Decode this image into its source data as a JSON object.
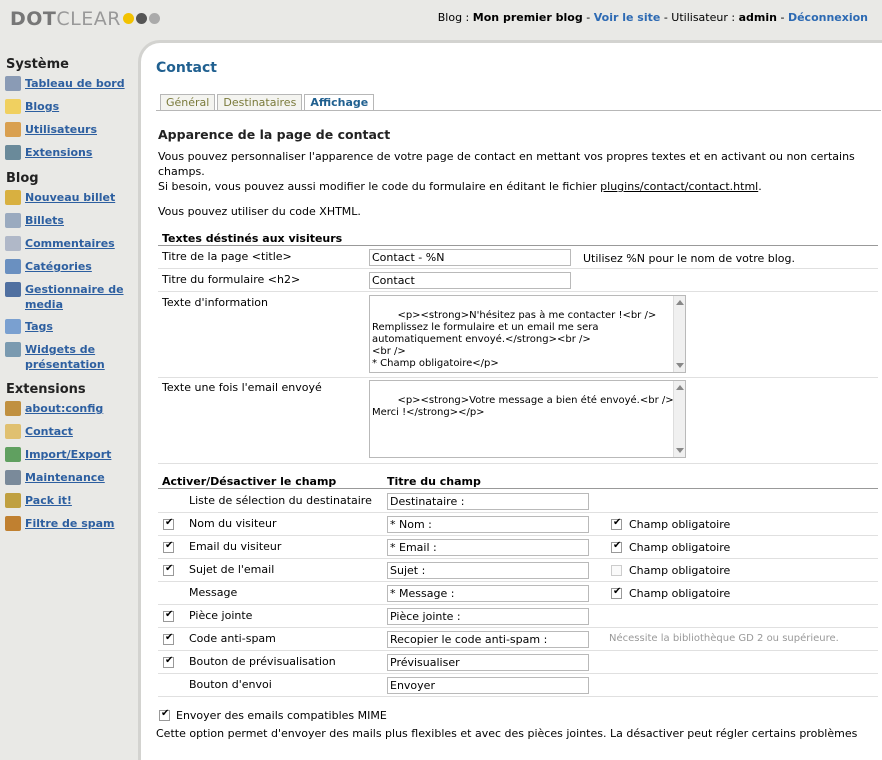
{
  "header": {
    "logo_a": "DOT",
    "logo_b": "CLEAR",
    "blog_label": "Blog :",
    "blog_name": "Mon premier blog",
    "sep1": "-",
    "view_site": "Voir le site",
    "sep2": "-",
    "user_label": "Utilisateur :",
    "user_name": "admin",
    "sep3": "-",
    "logout": "Déconnexion",
    "dot_colors": [
      "#f2c200",
      "#555555",
      "#aaaaaa"
    ]
  },
  "sidebar": {
    "system_title": "Système",
    "system": [
      {
        "label": "Tableau de bord",
        "icon": "dashboard-icon",
        "color": "#8a9bb5"
      },
      {
        "label": "Blogs",
        "icon": "blogs-icon",
        "color": "#f0d060"
      },
      {
        "label": "Utilisateurs",
        "icon": "users-icon",
        "color": "#d9a050"
      },
      {
        "label": "Extensions",
        "icon": "plugins-icon",
        "color": "#6a8a9a"
      }
    ],
    "blog_title": "Blog",
    "blog": [
      {
        "label": "Nouveau billet",
        "icon": "new-post-icon",
        "color": "#d8b040"
      },
      {
        "label": "Billets",
        "icon": "posts-icon",
        "color": "#9aaabf"
      },
      {
        "label": "Commentaires",
        "icon": "comments-icon",
        "color": "#b0b8c8"
      },
      {
        "label": "Catégories",
        "icon": "categories-icon",
        "color": "#6a90c0"
      },
      {
        "label": "Gestionnaire de media",
        "icon": "media-icon",
        "color": "#5070a0"
      },
      {
        "label": "Tags",
        "icon": "tags-icon",
        "color": "#7aa0d0"
      },
      {
        "label": "Widgets de présentation",
        "icon": "widgets-icon",
        "color": "#7a9ab0"
      }
    ],
    "ext_title": "Extensions",
    "ext": [
      {
        "label": "about:config",
        "icon": "config-icon",
        "color": "#c09040"
      },
      {
        "label": "Contact",
        "icon": "contact-icon",
        "color": "#e0c070"
      },
      {
        "label": "Import/Export",
        "icon": "import-export-icon",
        "color": "#60a060"
      },
      {
        "label": "Maintenance",
        "icon": "maintenance-icon",
        "color": "#7a8a9a"
      },
      {
        "label": "Pack it!",
        "icon": "pack-icon",
        "color": "#c0a040"
      },
      {
        "label": "Filtre de spam",
        "icon": "spam-filter-icon",
        "color": "#c08030"
      }
    ]
  },
  "page": {
    "title": "Contact",
    "tabs": [
      "Général",
      "Destinataires",
      "Affichage"
    ],
    "section_title": "Apparence de la page de contact",
    "intro1": "Vous pouvez personnaliser l'apparence de votre page de contact en mettant vos propres textes et en activant ou non certains champs.",
    "intro2_prefix": "Si besoin, vous pouvez aussi modifier le code du formulaire en éditant le fichier ",
    "intro2_link": "plugins/contact/contact.html",
    "intro2_suffix": ".",
    "intro3": "Vous pouvez utiliser du code XHTML.",
    "visitor_texts_title": "Textes déstinés aux visiteurs",
    "page_title_label": "Titre de la page <title>",
    "page_title_value": "Contact - %N",
    "page_title_hint": "Utilisez %N pour le nom de votre blog.",
    "form_title_label": "Titre du formulaire <h2>",
    "form_title_value": "Contact",
    "info_label": "Texte d'information",
    "info_value": "<p><strong>N'hésitez pas à me contacter !<br />\nRemplissez le formulaire et un email me sera automatiquement envoyé.</strong><br />\n<br />\n* Champ obligatoire</p>",
    "sent_label": "Texte une fois l'email envoyé",
    "sent_value": "<p><strong>Votre message a bien été envoyé.<br />\nMerci !</strong></p>",
    "col_toggle": "Activer/Désactiver le champ",
    "col_title": "Titre du champ",
    "required_label": "Champ obligatoire",
    "fields": [
      {
        "label": "Liste de sélection du destinataire",
        "value": "Destinataire :"
      },
      {
        "label": "Nom du visiteur",
        "value": "* Nom :"
      },
      {
        "label": "Email du visiteur",
        "value": "* Email :"
      },
      {
        "label": "Sujet de l'email",
        "value": "Sujet :"
      },
      {
        "label": "Message",
        "value": "* Message :"
      },
      {
        "label": "Pièce jointe",
        "value": "Pièce jointe :"
      },
      {
        "label": "Code anti-spam",
        "value": "Recopier le code anti-spam :"
      },
      {
        "label": "Bouton de prévisualisation",
        "value": "Prévisualiser"
      },
      {
        "label": "Bouton d'envoi",
        "value": "Envoyer"
      }
    ],
    "gd_note": "Nécessite la bibliothèque GD 2 ou supérieure.",
    "mime_label": "Envoyer des emails compatibles MIME",
    "mime_desc": "Cette option permet d'envoyer des mails plus flexibles et avec des pièces jointes. La désactiver peut régler certains problèmes"
  }
}
